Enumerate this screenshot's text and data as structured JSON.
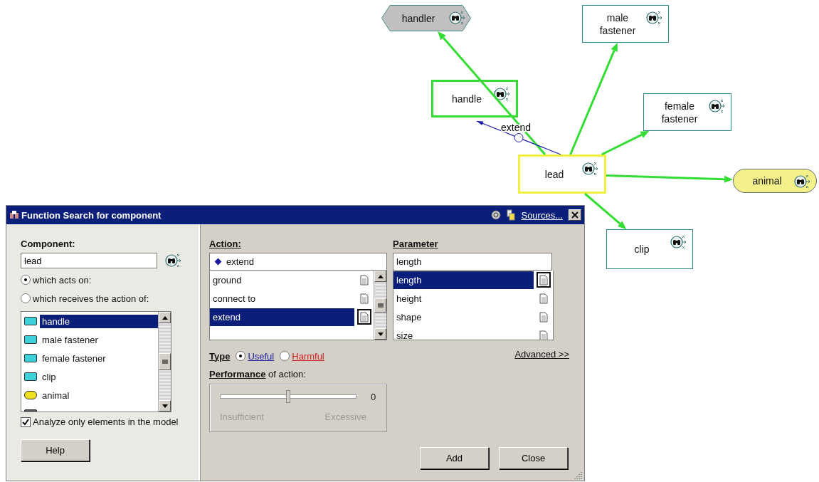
{
  "diagram": {
    "nodes": [
      {
        "label": "handler",
        "kind": "hexagon",
        "color": "#c0c0c0"
      },
      {
        "label": "male\nfastener",
        "kind": "box",
        "color": "#2e8b8b"
      },
      {
        "label": "handle",
        "kind": "box",
        "color": "#33dd33"
      },
      {
        "label": "female\nfastener",
        "kind": "box",
        "color": "#2e8b8b"
      },
      {
        "label": "lead",
        "kind": "box",
        "color": "#f0f040"
      },
      {
        "label": "animal",
        "kind": "pill",
        "color": "#607070"
      },
      {
        "label": "clip",
        "kind": "box",
        "color": "#2e8b8b"
      }
    ],
    "edges": [
      {
        "kind": "link"
      },
      {
        "kind": "link"
      },
      {
        "kind": "link"
      },
      {
        "kind": "link"
      },
      {
        "kind": "link"
      },
      {
        "kind": "function",
        "label": "extend"
      }
    ]
  },
  "dialog": {
    "title": "Function Search for component",
    "sources_link": "Sources...",
    "component": {
      "label": "Component:",
      "value": "lead",
      "radios": [
        {
          "label": "which acts on:",
          "selected": true
        },
        {
          "label": "which receives the action of:",
          "selected": false
        }
      ],
      "items": [
        {
          "label": "handle",
          "kind": "component",
          "selected": true
        },
        {
          "label": "male fastener",
          "kind": "component",
          "selected": false
        },
        {
          "label": "female fastener",
          "kind": "component",
          "selected": false
        },
        {
          "label": "clip",
          "kind": "component",
          "selected": false
        },
        {
          "label": "animal",
          "kind": "supersystem",
          "selected": false
        },
        {
          "kind": "product",
          "selected": false
        }
      ],
      "checkbox": {
        "label": "Analyze only elements in the model",
        "checked": true
      },
      "help_button": "Help"
    },
    "action": {
      "label": "Action:",
      "value": "extend",
      "items": [
        {
          "label": "ground",
          "selected": false
        },
        {
          "label": "connect to",
          "selected": false
        },
        {
          "label": "extend",
          "selected": true
        }
      ]
    },
    "type": {
      "label": "Type",
      "options": [
        {
          "label": "Useful",
          "kind": "useful",
          "selected": true
        },
        {
          "label": "Harmful",
          "kind": "harmful",
          "selected": false
        }
      ]
    },
    "performance": {
      "label": "**Performance** of action:",
      "level": 0.5,
      "reading": "0",
      "min_label": "Insufficient",
      "max_label": "Excessive",
      "disabled": true
    },
    "parameter": {
      "label": "Parameter",
      "value": "length",
      "items": [
        {
          "label": "length",
          "selected": true
        },
        {
          "label": "height",
          "selected": false
        },
        {
          "label": "shape",
          "selected": false
        },
        {
          "label": "size",
          "selected": false
        }
      ]
    },
    "advanced_link": "Advanced >>",
    "buttons": [
      "Add",
      "Close"
    ]
  }
}
